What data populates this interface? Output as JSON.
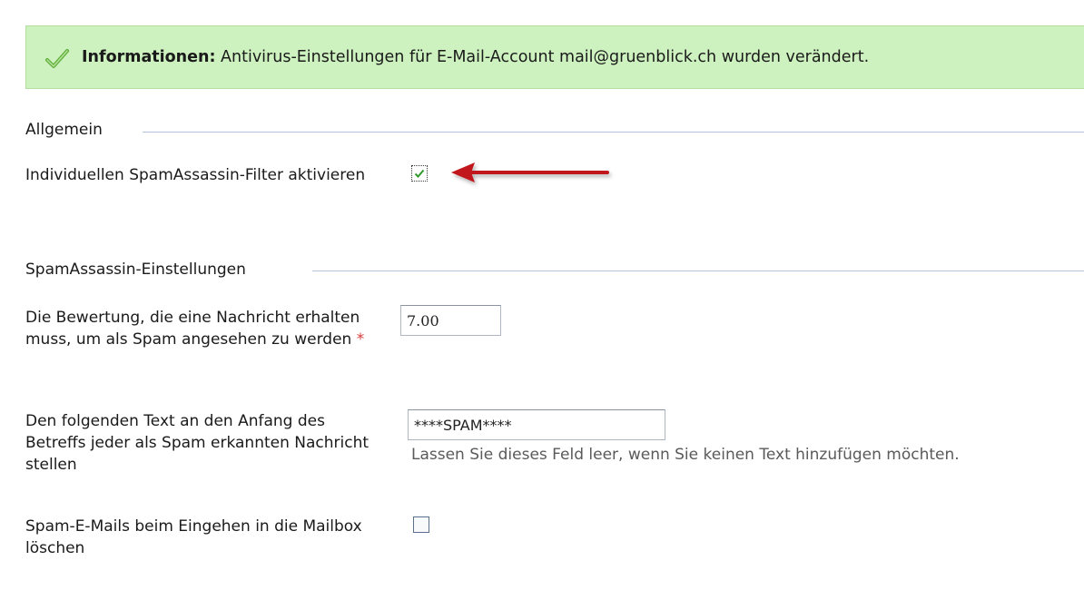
{
  "info": {
    "title": "Informationen:",
    "message": "Antivirus-Einstellungen für E-Mail-Account mail@gruenblick.ch wurden verändert.",
    "icon": "checkmark-icon",
    "bg_color": "#cdf2bf"
  },
  "sections": {
    "general": "Allgemein",
    "spamassassin": "SpamAssassin-Einstellungen"
  },
  "fields": {
    "individual_filter": {
      "label": "Individuellen SpamAssassin-Filter aktivieren",
      "checked": true
    },
    "score": {
      "label": "Die Bewertung, die eine Nachricht erhalten muss, um als Spam angesehen zu werden",
      "required_mark": "*",
      "value": "7.00"
    },
    "subject_prefix": {
      "label": "Den folgenden Text an den Anfang des Betreffs jeder als Spam erkannten Nachricht stellen",
      "value": "****SPAM****",
      "hint": "Lassen Sie dieses Feld leer, wenn Sie keinen Text hinzufügen möchten."
    },
    "delete_on_arrival": {
      "label": "Spam-E-Mails beim Eingehen in die Mailbox löschen",
      "checked": false
    }
  },
  "annotation": {
    "icon": "red-arrow-icon",
    "color": "#c0171c"
  }
}
